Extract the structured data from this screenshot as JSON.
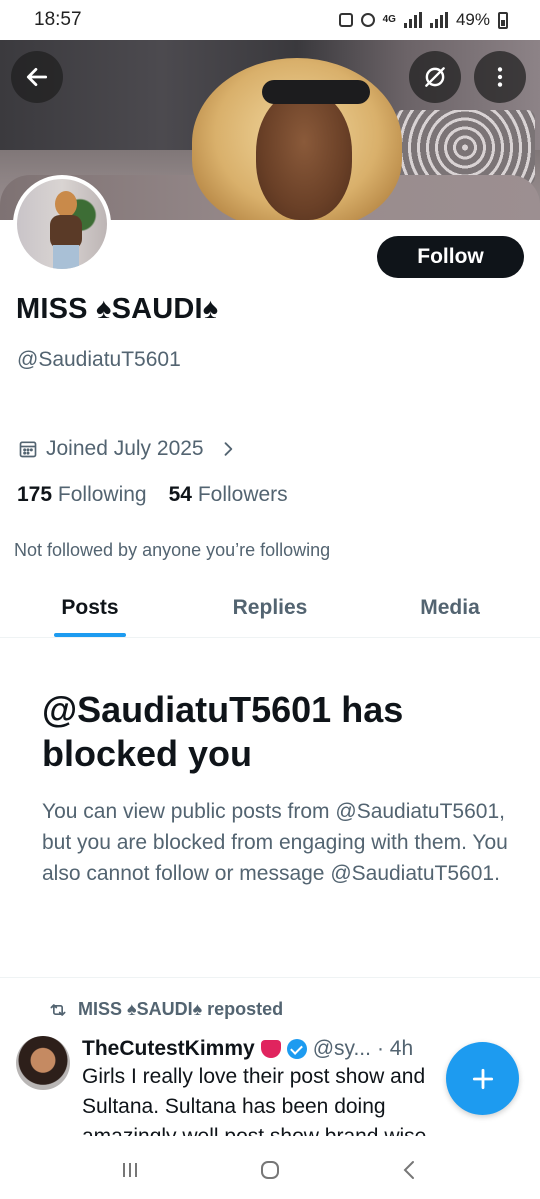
{
  "status_bar": {
    "time": "18:57",
    "network": "4G",
    "battery": "49%"
  },
  "profile": {
    "name": "MISS ♠SAUDI♠",
    "handle": "@SaudiatuT5601",
    "joined": "Joined July 2025",
    "following_count": "175",
    "following_label": "Following",
    "followers_count": "54",
    "followers_label": "Followers",
    "not_followed": "Not followed by anyone you’re following",
    "follow_label": "Follow"
  },
  "tabs": [
    {
      "label": "Posts",
      "active": true
    },
    {
      "label": "Replies"
    },
    {
      "label": "Media"
    }
  ],
  "blocked": {
    "title": "@SaudiatuT5601 has blocked you",
    "message": "You can view public posts from @SaudiatuT5601, but you are blocked from engaging with them. You also cannot follow or message @SaudiatuT5601."
  },
  "repost": {
    "label": "MISS ♠SAUDI♠ reposted"
  },
  "tweet": {
    "display_name": "TheCutestKimmy",
    "handle": "@sy...",
    "time": "· 4h",
    "text": "Girls I really love their post show and Sultana. Sultana has been doing amazingly well post show brand wise"
  },
  "icons": {
    "back": "back-arrow-icon",
    "no_translate": "circle-slash-icon",
    "more": "more-vertical-icon",
    "calendar": "calendar-icon",
    "chevron": "chevron-right-icon",
    "repost": "repost-icon",
    "compose": "plus-icon"
  },
  "colors": {
    "accent": "#1d9bf0",
    "text": "#0f1419",
    "muted": "#536471"
  }
}
